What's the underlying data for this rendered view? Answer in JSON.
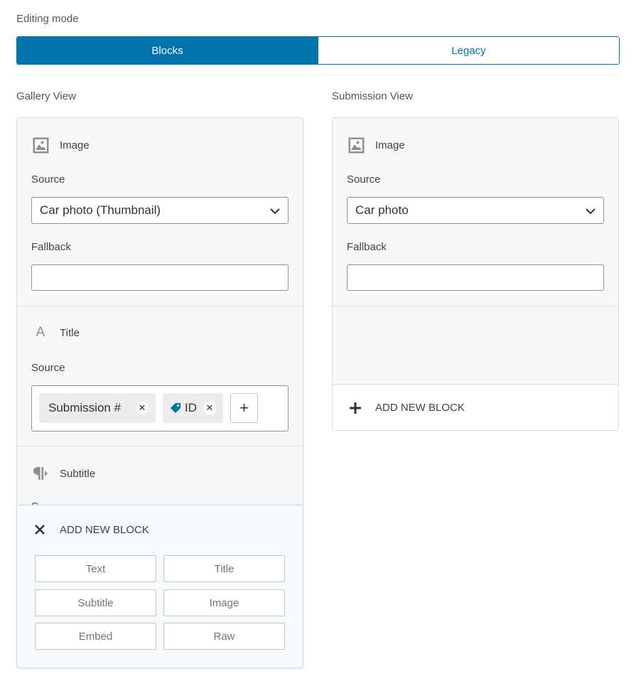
{
  "editing_mode": {
    "label": "Editing mode",
    "options": [
      "Blocks",
      "Legacy"
    ],
    "selected": "Blocks"
  },
  "gallery": {
    "heading": "Gallery View",
    "image_block": {
      "title": "Image",
      "icon": "image-icon",
      "source_label": "Source",
      "source_value": "Car photo (Thumbnail)",
      "fallback_label": "Fallback",
      "fallback_value": ""
    },
    "title_block": {
      "title": "Title",
      "icon": "letter-a-icon",
      "source_label": "Source",
      "tokens": [
        "Submission #",
        "ID"
      ],
      "token_icons": [
        "",
        "tag-icon"
      ],
      "add_token": "+"
    },
    "subtitle_block": {
      "title": "Subtitle",
      "icon": "paragraph-icon",
      "source_label_partial": "S"
    }
  },
  "add_block_popover": {
    "title": "ADD NEW BLOCK",
    "close_icon": "close-icon",
    "options": [
      "Text",
      "Title",
      "Subtitle",
      "Image",
      "Embed",
      "Raw"
    ]
  },
  "submission": {
    "heading": "Submission View",
    "image_block": {
      "title": "Image",
      "icon": "image-icon",
      "source_label": "Source",
      "source_value": "Car photo",
      "fallback_label": "Fallback",
      "fallback_value": ""
    },
    "add_block": {
      "label": "ADD NEW BLOCK",
      "icon": "plus-icon"
    }
  },
  "colors": {
    "accent": "#0073aa",
    "panel_bg": "#f8f8f8",
    "popover_bg": "#f5fafd"
  }
}
